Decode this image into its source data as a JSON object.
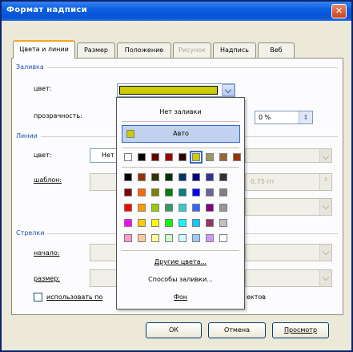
{
  "window": {
    "title": "Формат надписи",
    "close": "✕"
  },
  "tabs": [
    {
      "label": "Цвета и линии",
      "state": "active"
    },
    {
      "label": "Размер",
      "state": "normal"
    },
    {
      "label": "Положение",
      "state": "normal"
    },
    {
      "label": "Рисунок",
      "state": "disabled"
    },
    {
      "label": "Надпись",
      "state": "normal"
    },
    {
      "label": "Веб",
      "state": "normal"
    }
  ],
  "fill": {
    "section": "Заливка",
    "color_label": "цвет:",
    "color_value": "#cccc00",
    "transparency_label": "прозрачность:",
    "transparency_value": "0 %"
  },
  "lines": {
    "section": "Линии",
    "color_label": "цвет:",
    "color_value_partial": "Нет",
    "pattern_label": "шаблон:",
    "weight_value": "0,75 пт"
  },
  "arrows": {
    "section": "Стрелки",
    "start_label": "начало:",
    "size_label": "размер:",
    "default_checkbox_partial_left": "использовать по",
    "default_checkbox_partial_right": "ектов"
  },
  "popup": {
    "no_fill": "Нет заливки",
    "auto": "Авто",
    "auto_color": "#cccc00",
    "recent_colors": [
      "#ffffff",
      "#000000",
      "#660000",
      "#990000",
      "#330000",
      "#cccc00",
      "#999966",
      "#996633",
      "#993300"
    ],
    "palette": [
      [
        "#000000",
        "#993300",
        "#333300",
        "#003300",
        "#003366",
        "#000080",
        "#333399",
        "#333333"
      ],
      [
        "#800000",
        "#ff6600",
        "#808000",
        "#008000",
        "#008080",
        "#0000ff",
        "#666699",
        "#808080"
      ],
      [
        "#ff0000",
        "#ff9900",
        "#99cc00",
        "#339966",
        "#33cccc",
        "#3366ff",
        "#800080",
        "#969696"
      ],
      [
        "#ff00ff",
        "#ffcc00",
        "#ffff00",
        "#00ff00",
        "#00ffff",
        "#00ccff",
        "#993366",
        "#c0c0c0"
      ],
      [
        "#ff99cc",
        "#ffcc99",
        "#ffff99",
        "#ccffcc",
        "#ccffff",
        "#99ccff",
        "#cc99ff",
        "#ffffff"
      ]
    ],
    "more_colors": "Другие цвета...",
    "fill_effects": "Способы заливки...",
    "background": "Фон"
  },
  "buttons": {
    "ok": "ОК",
    "cancel": "Отмена",
    "preview": "Просмотр"
  }
}
